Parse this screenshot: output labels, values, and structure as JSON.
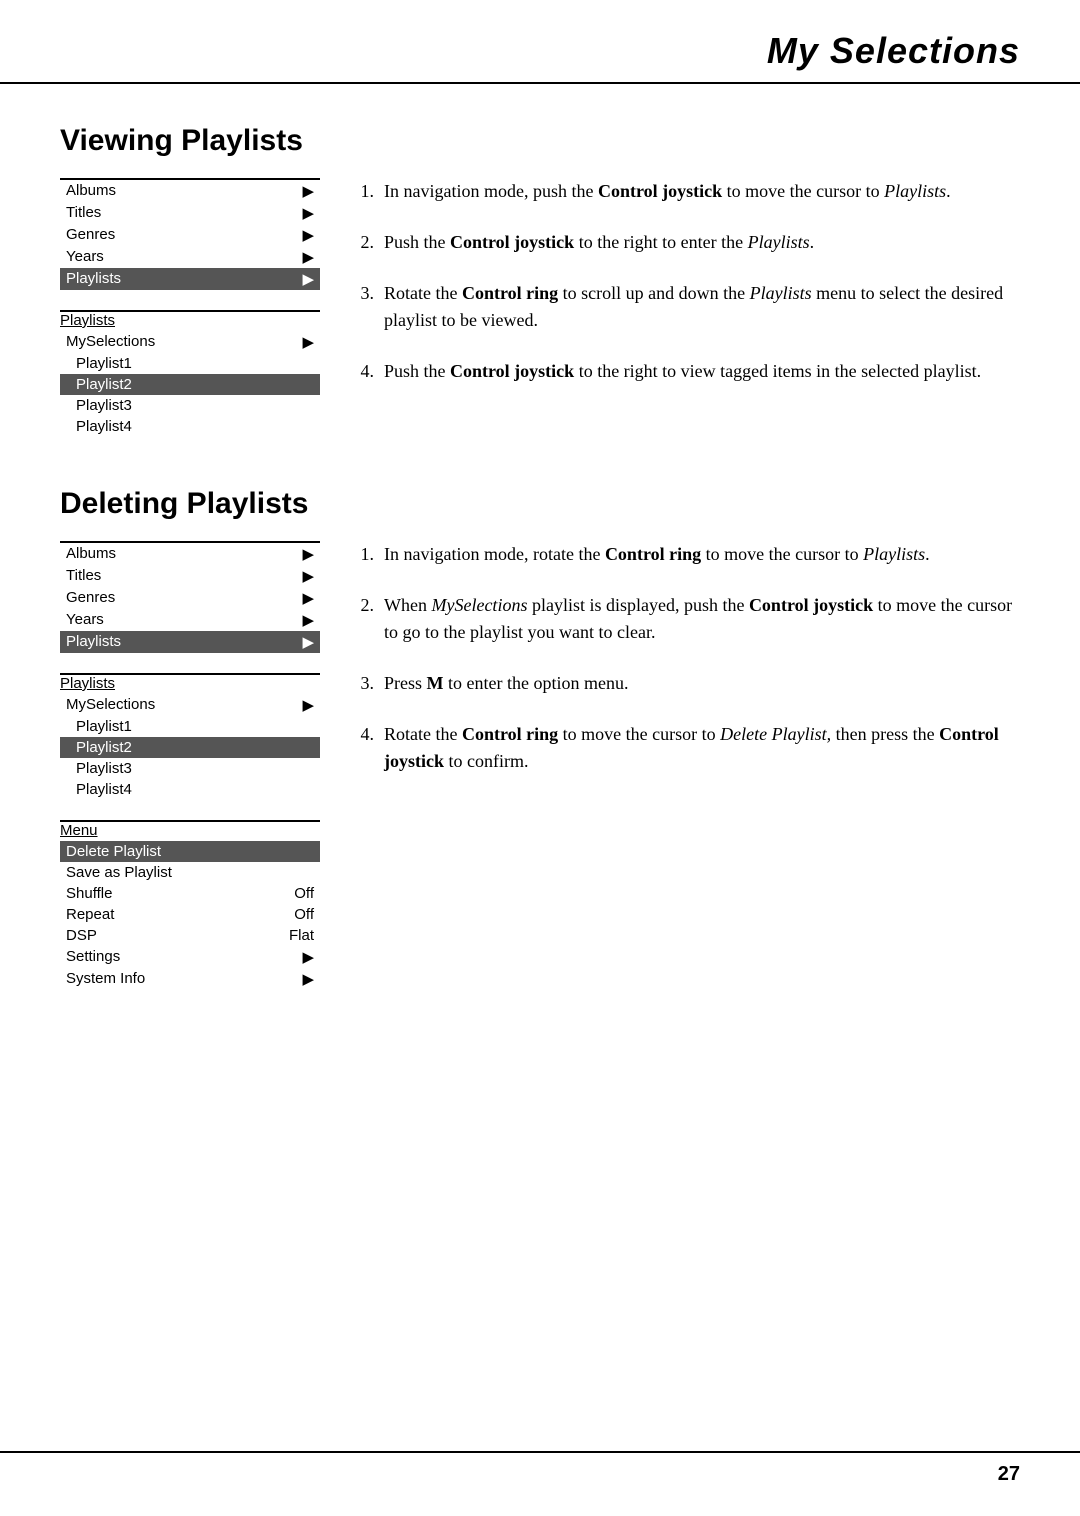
{
  "header": {
    "title": "My Selections"
  },
  "footer": {
    "page_number": "27"
  },
  "viewing_section": {
    "heading": "Viewing Playlists",
    "menu1": {
      "items": [
        {
          "label": "Albums",
          "arrow": "▶",
          "selected": false
        },
        {
          "label": "Titles",
          "arrow": "▶",
          "selected": false
        },
        {
          "label": "Genres",
          "arrow": "▶",
          "selected": false
        },
        {
          "label": "Years",
          "arrow": "▶",
          "selected": false
        },
        {
          "label": "Playlists",
          "arrow": "▶",
          "selected": true
        }
      ]
    },
    "menu2": {
      "label": "Playlists",
      "items": [
        {
          "label": "MySelections",
          "arrow": "▶",
          "selected": false,
          "indent": false
        },
        {
          "label": "Playlist1",
          "arrow": "",
          "selected": false,
          "indent": true
        },
        {
          "label": "Playlist2",
          "arrow": "",
          "selected": true,
          "indent": true
        },
        {
          "label": "Playlist3",
          "arrow": "",
          "selected": false,
          "indent": true
        },
        {
          "label": "Playlist4",
          "arrow": "",
          "selected": false,
          "indent": true
        }
      ]
    },
    "steps": [
      {
        "num": "1.",
        "text": "In navigation mode, push the <strong>Control joystick</strong> to move the cursor to <em>Playlists</em>."
      },
      {
        "num": "2.",
        "text": "Push the <strong>Control joystick</strong> to the right to enter the <em>Playlists</em>."
      },
      {
        "num": "3.",
        "text": "Rotate the <strong>Control ring</strong> to scroll up and down the <em>Playlists</em> menu to select the desired playlist to be viewed."
      },
      {
        "num": "4.",
        "text": "Push the <strong>Control joystick</strong> to the right to view tagged items in the selected playlist."
      }
    ]
  },
  "deleting_section": {
    "heading": "Deleting Playlists",
    "menu1": {
      "items": [
        {
          "label": "Albums",
          "arrow": "▶",
          "selected": false
        },
        {
          "label": "Titles",
          "arrow": "▶",
          "selected": false
        },
        {
          "label": "Genres",
          "arrow": "▶",
          "selected": false
        },
        {
          "label": "Years",
          "arrow": "▶",
          "selected": false
        },
        {
          "label": "Playlists",
          "arrow": "▶",
          "selected": true
        }
      ]
    },
    "menu2": {
      "label": "Playlists",
      "items": [
        {
          "label": "MySelections",
          "arrow": "▶",
          "selected": false,
          "indent": false
        },
        {
          "label": "Playlist1",
          "arrow": "",
          "selected": false,
          "indent": true
        },
        {
          "label": "Playlist2",
          "arrow": "",
          "selected": true,
          "indent": true
        },
        {
          "label": "Playlist3",
          "arrow": "",
          "selected": false,
          "indent": true
        },
        {
          "label": "Playlist4",
          "arrow": "",
          "selected": false,
          "indent": true
        }
      ]
    },
    "menu3": {
      "label": "Menu",
      "items": [
        {
          "label": "Delete Playlist",
          "value": "",
          "arrow": "",
          "selected": true
        },
        {
          "label": "Save as Playlist",
          "value": "",
          "arrow": "",
          "selected": false
        },
        {
          "label": "Shuffle",
          "value": "Off",
          "arrow": "",
          "selected": false
        },
        {
          "label": "Repeat",
          "value": "Off",
          "arrow": "",
          "selected": false
        },
        {
          "label": "DSP",
          "value": "Flat",
          "arrow": "",
          "selected": false
        },
        {
          "label": "Settings",
          "value": "",
          "arrow": "▶",
          "selected": false
        },
        {
          "label": "System Info",
          "value": "",
          "arrow": "▶",
          "selected": false
        }
      ]
    },
    "steps": [
      {
        "num": "1.",
        "text": "In navigation mode, rotate the <strong>Control ring</strong> to move the cursor to <em>Playlists</em>."
      },
      {
        "num": "2.",
        "text": "When <em>MySelections</em> playlist is displayed, push the <strong>Control joystick</strong> to move the cursor to go to the playlist you want to clear."
      },
      {
        "num": "3.",
        "text": "Press <strong>M</strong> to enter the option menu."
      },
      {
        "num": "4.",
        "text": "Rotate the <strong>Control ring</strong> to move the cursor to <em>Delete Playlist,</em> then press the <strong>Control joystick</strong> to confirm."
      }
    ]
  }
}
